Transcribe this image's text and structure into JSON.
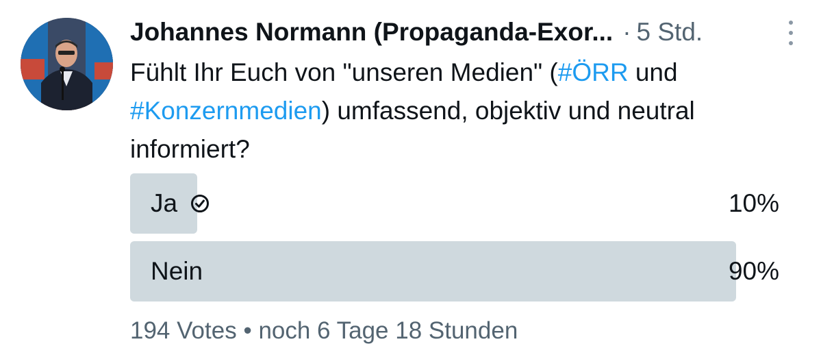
{
  "author": {
    "name": "Johannes Normann (Propaganda-Exor...",
    "separator": "·",
    "time": "5 Std."
  },
  "tweet": {
    "parts": [
      "Fühlt Ihr Euch von \"unseren Medien\" (",
      "#ÖRR",
      " und ",
      "#Konzernmedien",
      ") umfassend, objektiv und neutral informiert?"
    ]
  },
  "poll": {
    "options": [
      {
        "label": "Ja",
        "percent_text": "10%",
        "share": 0.1,
        "voted": true
      },
      {
        "label": "Nein",
        "percent_text": "90%",
        "share": 0.9,
        "voted": false
      }
    ],
    "votes": "194 Votes",
    "bullet": "•",
    "remaining": "noch 6 Tage 18 Stunden"
  },
  "icons": {
    "avatar": "avatar-photo",
    "more": "more-vertical-icon",
    "check": "check-circle-icon"
  },
  "colors": {
    "hashtag": "#1d9bf0",
    "poll_fill": "#cfd9de",
    "secondary_text": "#536471"
  }
}
